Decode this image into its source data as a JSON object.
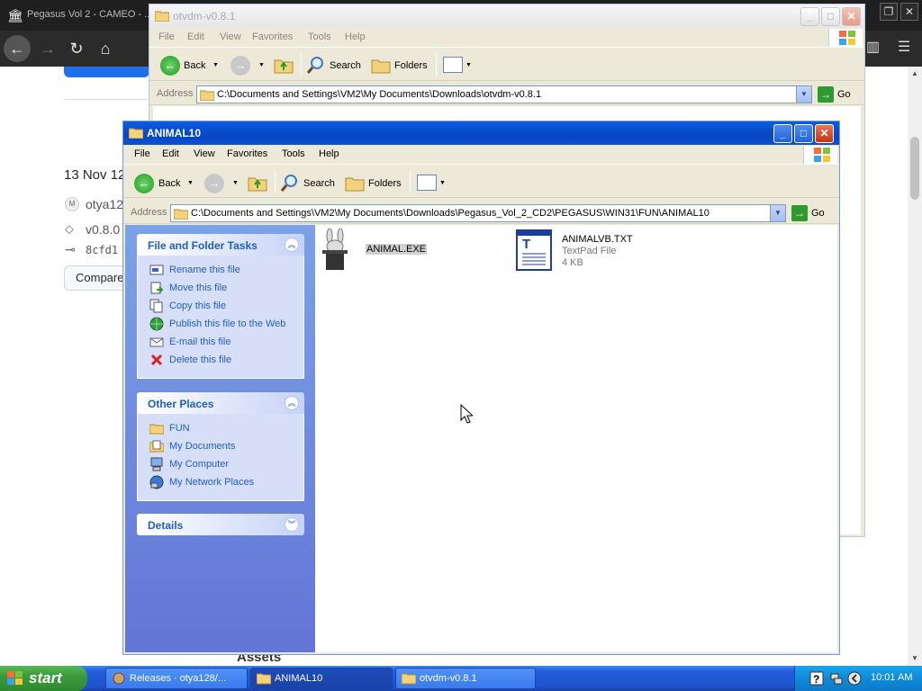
{
  "browser": {
    "tab_title": "Pegasus Vol 2 - CAMEO - ...",
    "controls": {
      "minimize": "─",
      "restore": "❐",
      "close": "✕"
    },
    "page": {
      "release_date": "13 Nov 12",
      "user": "otya12",
      "tag": "v0.8.0",
      "commit": "8cfd1",
      "compare_button": "Compare",
      "bottom_heading": "Assets"
    }
  },
  "back_window": {
    "title": "otvdm-v0.8.1",
    "menu": [
      "File",
      "Edit",
      "View",
      "Favorites",
      "Tools",
      "Help"
    ],
    "toolbar": {
      "back": "Back",
      "search": "Search",
      "folders": "Folders"
    },
    "address_label": "Address",
    "address": "C:\\Documents and Settings\\VM2\\My Documents\\Downloads\\otvdm-v0.8.1",
    "go": "Go"
  },
  "front_window": {
    "title": "ANIMAL10",
    "menu": [
      "File",
      "Edit",
      "View",
      "Favorites",
      "Tools",
      "Help"
    ],
    "toolbar": {
      "back": "Back",
      "search": "Search",
      "folders": "Folders"
    },
    "address_label": "Address",
    "address": "C:\\Documents and Settings\\VM2\\My Documents\\Downloads\\Pegasus_Vol_2_CD2\\PEGASUS\\WIN31\\FUN\\ANIMAL10",
    "go": "Go",
    "file_tasks": {
      "title": "File and Folder Tasks",
      "items": [
        {
          "label": "Rename this file",
          "icon": "rename-icon"
        },
        {
          "label": "Move this file",
          "icon": "move-icon"
        },
        {
          "label": "Copy this file",
          "icon": "copy-icon"
        },
        {
          "label": "Publish this file to the Web",
          "icon": "globe-icon"
        },
        {
          "label": "E-mail this file",
          "icon": "email-icon"
        },
        {
          "label": "Delete this file",
          "icon": "delete-icon"
        }
      ]
    },
    "other_places": {
      "title": "Other Places",
      "items": [
        {
          "label": "FUN",
          "icon": "folder-icon"
        },
        {
          "label": "My Documents",
          "icon": "my-documents-icon"
        },
        {
          "label": "My Computer",
          "icon": "my-computer-icon"
        },
        {
          "label": "My Network Places",
          "icon": "network-places-icon"
        }
      ]
    },
    "details": {
      "title": "Details"
    },
    "files": [
      {
        "name": "ANIMAL.EXE",
        "icon": "rabbit-hat-icon",
        "selected": true
      },
      {
        "name": "ANIMALVB.TXT",
        "type": "TextPad File",
        "size": "4 KB",
        "icon": "textpad-icon"
      }
    ]
  },
  "taskbar": {
    "start": "start",
    "buttons": [
      {
        "label": "Releases · otya128/...",
        "active": false
      },
      {
        "label": "ANIMAL10",
        "active": true
      },
      {
        "label": "otvdm-v0.8.1",
        "active": false
      }
    ],
    "clock": "10:01 AM"
  }
}
